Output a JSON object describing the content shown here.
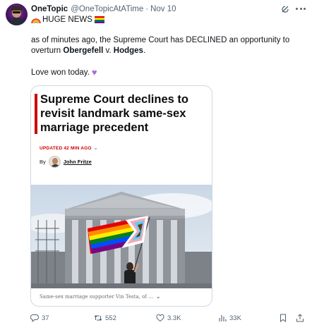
{
  "tweet": {
    "display_name": "OneTopic",
    "handle": "@OneTopicAtATime",
    "separator": "·",
    "date": "Nov 10",
    "line1": "HUGE NEWS",
    "body_part1": "as of minutes ago, the Supreme Court has DECLINED an opportunity to overturn ",
    "body_bold1": "Obergefell",
    "body_mid": " v. ",
    "body_bold2": "Hodges",
    "body_end": ".",
    "love_text": "Love won today."
  },
  "card": {
    "headline": "Supreme Court declines to revisit landmark same-sex marriage precedent",
    "updated": "UPDATED 42 MIN AGO",
    "byline_prefix": "By",
    "author": "John Fritze",
    "caption": "Same-sex marriage supporter Vin Testa, of ...",
    "accent_color": "#cc0000"
  },
  "actions": {
    "replies": "37",
    "reposts": "552",
    "likes": "3.3K",
    "views": "33K"
  },
  "icons": [
    "grok-icon",
    "more-icon",
    "rainbow-emoji",
    "rainbow-flag-emoji",
    "purple-heart-emoji",
    "reply-icon",
    "repost-icon",
    "like-icon",
    "views-icon",
    "bookmark-icon",
    "share-icon"
  ]
}
